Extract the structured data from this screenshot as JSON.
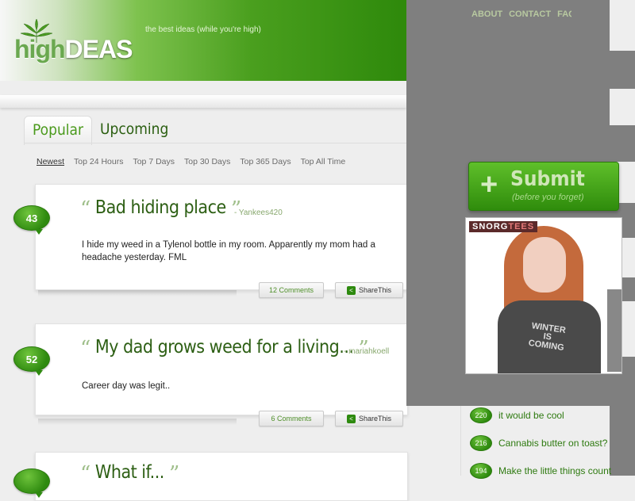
{
  "header": {
    "logo_prefix": "high",
    "logo_suffix": "DEAS",
    "tagline": "the best ideas (while you're high)",
    "nav": [
      "ABOUT",
      "CONTACT",
      "FAQS"
    ]
  },
  "tabs": {
    "popular": "Popular",
    "upcoming": "Upcoming"
  },
  "filters": [
    "Newest",
    "Top 24 Hours",
    "Top 7 Days",
    "Top 30 Days",
    "Top 365 Days",
    "Top All Time"
  ],
  "posts": [
    {
      "votes": "43",
      "title": "Bad hiding place",
      "author": "- Yankees420",
      "body": "I hide my weed in a Tylenol bottle in my room. Apparently my mom had a headache yesterday. FML",
      "comments": "12 Comments",
      "share": "ShareThis"
    },
    {
      "votes": "52",
      "title": "My dad grows weed for a living...",
      "author": "- mariahkoell",
      "body": "Career day was legit..",
      "comments": "6 Comments",
      "share": "ShareThis"
    },
    {
      "title": "What if..."
    }
  ],
  "submit": {
    "plus": "+",
    "title": "Submit",
    "subtitle": "(before you forget)"
  },
  "ad": {
    "brand_a": "SNORG",
    "brand_b": "TEES",
    "shirt_line1": "WINTER",
    "shirt_line2": "IS",
    "shirt_line3": "COMING"
  },
  "sidebar": {
    "items": [
      {
        "count": "220",
        "text": "it would be cool"
      },
      {
        "count": "216",
        "text": "Cannabis butter on toast?"
      },
      {
        "count": "194",
        "text": "Make the little things count"
      }
    ]
  },
  "colors": {
    "brand_green": "#2f8a0c",
    "title_green": "#2d5f14",
    "overlay_gray": "#7f7f7f"
  }
}
